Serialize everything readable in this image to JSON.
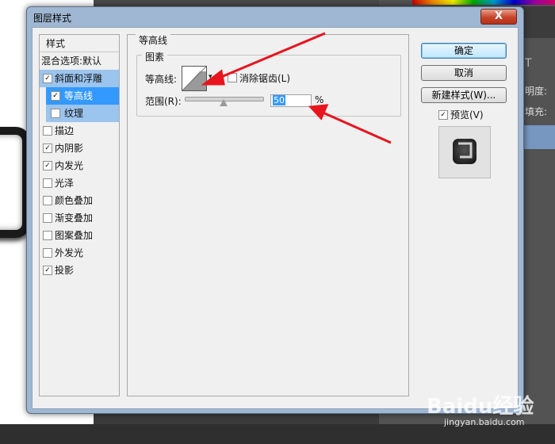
{
  "background": {
    "right_panel_labels": [
      "明度:",
      "填充:"
    ],
    "text_tool_glyph": "T"
  },
  "dialog": {
    "title": "图层样式",
    "close_glyph": "X"
  },
  "style_list": {
    "header": "样式",
    "blend_options": "混合选项:默认",
    "items": [
      {
        "label": "斜面和浮雕",
        "checked": true
      },
      {
        "label": "等高线",
        "checked": true
      },
      {
        "label": "纹理",
        "checked": false
      },
      {
        "label": "描边",
        "checked": false
      },
      {
        "label": "内阴影",
        "checked": true
      },
      {
        "label": "内发光",
        "checked": true
      },
      {
        "label": "光泽",
        "checked": false
      },
      {
        "label": "颜色叠加",
        "checked": false
      },
      {
        "label": "渐变叠加",
        "checked": false
      },
      {
        "label": "图案叠加",
        "checked": false
      },
      {
        "label": "外发光",
        "checked": false
      },
      {
        "label": "投影",
        "checked": true
      }
    ]
  },
  "contour_panel": {
    "group_title": "等高线",
    "sub_group_title": "图素",
    "contour_label": "等高线:",
    "anti_alias_label": "消除锯齿(L)",
    "anti_alias_checked": false,
    "range_label": "范围(R):",
    "range_value": "50",
    "range_unit": "%",
    "range_fraction": 0.5
  },
  "buttons": {
    "ok": "确定",
    "cancel": "取消",
    "new_style": "新建样式(W)...",
    "preview_label": "预览(V)",
    "preview_checked": true
  },
  "watermark": {
    "main": "Baidu经验",
    "sub": "jingyan.baidu.com"
  },
  "colors": {
    "selection": "#3399ff",
    "arrow": "#e8141e",
    "title_bar": "#9fb7d2"
  }
}
